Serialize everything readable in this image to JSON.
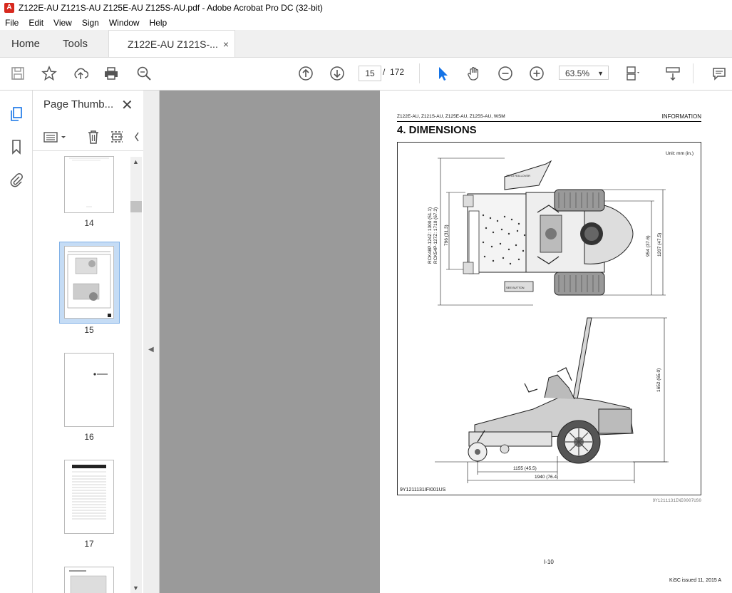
{
  "window": {
    "title": "Z122E-AU Z121S-AU Z125E-AU Z125S-AU.pdf - Adobe Acrobat Pro DC (32-bit)"
  },
  "menu": [
    "File",
    "Edit",
    "View",
    "Sign",
    "Window",
    "Help"
  ],
  "tabs": {
    "home": "Home",
    "tools": "Tools",
    "document": "Z122E-AU Z121S-...",
    "close": "×"
  },
  "toolbar": {
    "current_page": "15",
    "separator": "/",
    "total_pages": "172",
    "zoom": "63.5%",
    "zoom_dropdown": "▼"
  },
  "panel": {
    "title": "Page Thumb...",
    "close": "✕",
    "thumbnails": [
      {
        "label": "14"
      },
      {
        "label": "15",
        "selected": true
      },
      {
        "label": "16"
      },
      {
        "label": "17"
      }
    ]
  },
  "document": {
    "header_left": "Z122E-AU, Z121S-AU, Z125E-AU, Z125S-AU, WSM",
    "header_right": "INFORMATION",
    "title": "4.  DIMENSIONS",
    "unit": "Unit: mm (in.)",
    "dims": {
      "top_len_a": "RCK48P-124Z: 1300 (51.1)",
      "top_len_b": "RCK54P-127Z: 1710 (67.3)",
      "top_796": "796 (31.3)",
      "top_954": "954 (37.6)",
      "top_1207": "1207 (47.5)",
      "side_height": "1652 (65.0)",
      "side_1155": "1155 (45.5)",
      "side_1940": "1940 (76.4)",
      "rops_label": "ZERO ROLLOVER",
      "deck_label": "SEE BUTTON"
    },
    "figure_id": "9Y1211131IFI001US",
    "figure_code": "9Y1211131INI0007US0",
    "page_number": "I-10",
    "issued": "KiSC issued 11, 2015 A"
  },
  "colors": {
    "viewer_bg": "#9a9a9a",
    "accent_blue": "#1473e6",
    "thumb_selected": "#c5dcf5"
  }
}
